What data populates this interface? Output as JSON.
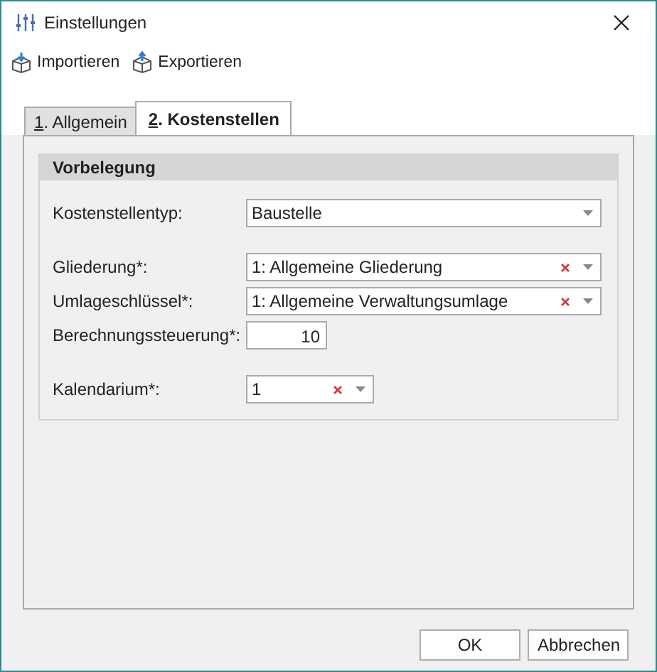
{
  "window": {
    "title": "Einstellungen"
  },
  "toolbar": [
    {
      "label": "Importieren"
    },
    {
      "label": "Exportieren"
    }
  ],
  "tabs": [
    {
      "label": "1. Allgemein",
      "selected": false
    },
    {
      "label": "2. Kostenstellen",
      "selected": true
    }
  ],
  "group": {
    "title": "Vorbelegung",
    "fields": [
      {
        "kind": "combo",
        "label": "Kostenstellentyp:",
        "value": "Baustelle",
        "clearable": false
      },
      {
        "kind": "combo",
        "label": "Gliederung*:",
        "value": "1: Allgemeine Gliederung",
        "clearable": true
      },
      {
        "kind": "combo",
        "label": "Umlageschlüssel*:",
        "value": "1: Allgemeine Verwaltungsumlage",
        "clearable": true
      },
      {
        "kind": "number",
        "label": "Berechnungssteuerung*:",
        "value": "10"
      },
      {
        "kind": "combo",
        "label": "Kalendarium*:",
        "value": "1",
        "clearable": true
      }
    ]
  },
  "buttons": [
    {
      "label": "OK"
    },
    {
      "label": "Abbrechen"
    }
  ]
}
